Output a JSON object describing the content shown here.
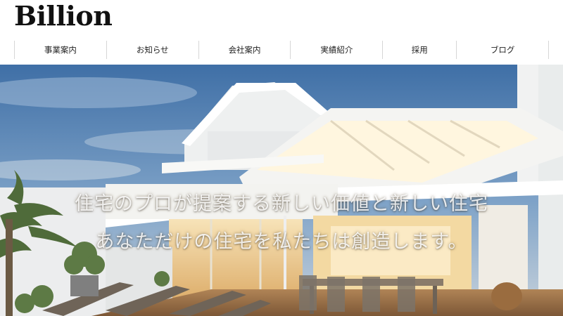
{
  "site": {
    "logo": "Billion"
  },
  "nav": {
    "items": [
      {
        "label": "事業案内"
      },
      {
        "label": "お知らせ"
      },
      {
        "label": "会社案内"
      },
      {
        "label": "実績紹介"
      },
      {
        "label": "採用"
      },
      {
        "label": "ブログ"
      }
    ]
  },
  "hero": {
    "line1": "住宅のプロが提案する新しい価値と新しい住宅",
    "line2": "あなただけの住宅を私たちは創造します。"
  }
}
